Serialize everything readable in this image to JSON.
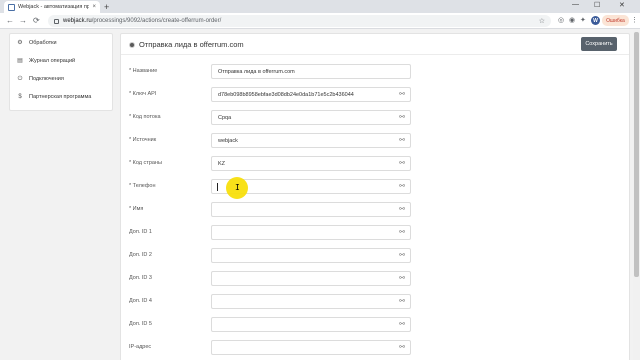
{
  "browser": {
    "tab_title": "Webjack - автоматизация про...",
    "tab_close": "×",
    "new_tab": "+",
    "win_min": "—",
    "win_max": "☐",
    "win_close": "✕",
    "url_host": "webjack.ru",
    "url_path": "/processings/9092/actions/create-offerrum-order/",
    "back": "←",
    "forward": "→",
    "reload": "⟳",
    "star": "☆",
    "profile_letter": "W",
    "error_label": "Ошибка",
    "menu": "⋮"
  },
  "sidebar": {
    "items": [
      {
        "label": "Обработки",
        "icon": "gear-icon"
      },
      {
        "label": "Журнал операций",
        "icon": "log-icon"
      },
      {
        "label": "Подключения",
        "icon": "plug-icon"
      },
      {
        "label": "Партнерская программа",
        "icon": "dollar-icon"
      }
    ]
  },
  "main": {
    "title": "Отправка лида в offerrum.com",
    "save_label": "Сохранить",
    "fields": [
      {
        "label": "* Название",
        "value": "Отправка лида в offerrum.com",
        "link": false
      },
      {
        "label": "* Ключ API",
        "value": "d78eb098b8958ebfae3d08db24e0da1b71e5c2b436044",
        "link": true
      },
      {
        "label": "* Код потока",
        "value": "Cpqa",
        "link": true
      },
      {
        "label": "* Источник",
        "value": "webjack",
        "link": true
      },
      {
        "label": "* Код страны",
        "value": "KZ",
        "link": true
      },
      {
        "label": "* Телефон",
        "value": "",
        "link": true
      },
      {
        "label": "* Имя",
        "value": "",
        "link": true
      },
      {
        "label": "Доп. ID 1",
        "value": "",
        "link": true
      },
      {
        "label": "Доп. ID 2",
        "value": "",
        "link": true
      },
      {
        "label": "Доп. ID 3",
        "value": "",
        "link": true
      },
      {
        "label": "Доп. ID 4",
        "value": "",
        "link": true
      },
      {
        "label": "Доп. ID 5",
        "value": "",
        "link": true
      },
      {
        "label": "IP-адрес",
        "value": "",
        "link": true
      }
    ]
  },
  "colors": {
    "accent": "#58626c",
    "cursor_highlight": "#f7de05"
  }
}
